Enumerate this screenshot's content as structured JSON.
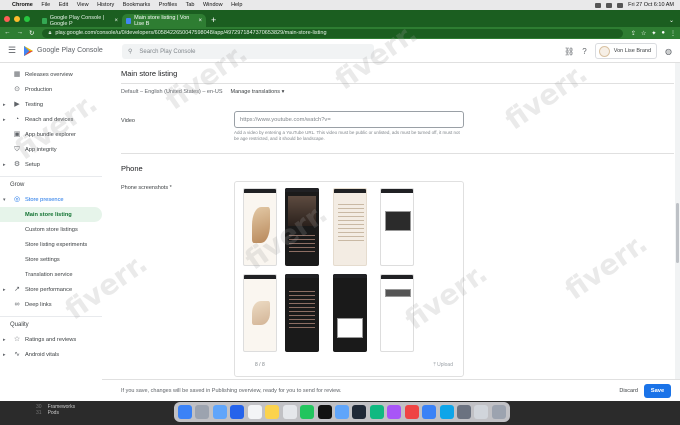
{
  "mac_menu": {
    "app": "Chrome",
    "items": [
      "File",
      "Edit",
      "View",
      "History",
      "Bookmarks",
      "Profiles",
      "Tab",
      "Window",
      "Help"
    ],
    "clock": "Fri 27 Oct 6:10 AM"
  },
  "browser": {
    "tabs": [
      {
        "label": "Google Play Console | Google P",
        "active": false
      },
      {
        "label": "Main store listing | Von Lise B",
        "active": true
      }
    ],
    "url": "play.google.com/console/u/0/developers/6058422650047598048/app/4972971847370653829/main-store-listing"
  },
  "header": {
    "brand": "Google Play Console",
    "search_placeholder": "Search Play Console",
    "account_name": "Von Lise Brand"
  },
  "sidebar": {
    "items": [
      {
        "label": "Releases overview",
        "icon": "releases-icon"
      },
      {
        "label": "Production",
        "icon": "production-icon"
      },
      {
        "label": "Testing",
        "icon": "testing-icon",
        "caret": true
      },
      {
        "label": "Reach and devices",
        "icon": "reach-icon",
        "caret": true
      },
      {
        "label": "App bundle explorer",
        "icon": "bundle-icon"
      },
      {
        "label": "App integrity",
        "icon": "integrity-icon"
      },
      {
        "label": "Setup",
        "icon": "setup-icon",
        "caret": true
      }
    ],
    "grow_section": "Grow",
    "store_presence": {
      "label": "Store presence",
      "children": [
        "Main store listing",
        "Custom store listings",
        "Store listing experiments",
        "Store settings",
        "Translation service"
      ]
    },
    "more_items": [
      {
        "label": "Store performance",
        "icon": "performance-icon",
        "caret": true
      },
      {
        "label": "Deep links",
        "icon": "link-icon"
      }
    ],
    "quality_section": "Quality",
    "quality_items": [
      {
        "label": "Ratings and reviews",
        "icon": "ratings-icon",
        "caret": true
      },
      {
        "label": "Android vitals",
        "icon": "vitals-icon",
        "caret": true
      }
    ]
  },
  "main": {
    "title": "Main store listing",
    "language": "Default – English (United States) – en-US",
    "manage_translations": "Manage translations",
    "video_label": "Video",
    "video_placeholder": "https://www.youtube.com/watch?v=",
    "video_help": "Add a video by entering a YouTube URL. This video must be public or unlisted, ads must be turned off, it must not be age restricted, and it should be landscape.",
    "phone_heading": "Phone",
    "screenshots_label": "Phone screenshots",
    "screenshot_count": "8 / 8",
    "upload_label": "Upload"
  },
  "footer": {
    "message": "If you save, changes will be saved in Publishing overview, ready for you to send for review.",
    "discard": "Discard",
    "save": "Save"
  },
  "terminal": {
    "lines": [
      {
        "num": "30",
        "text": "Frameworks"
      },
      {
        "num": "31",
        "text": "Pods"
      }
    ]
  },
  "watermark": "fiverr."
}
